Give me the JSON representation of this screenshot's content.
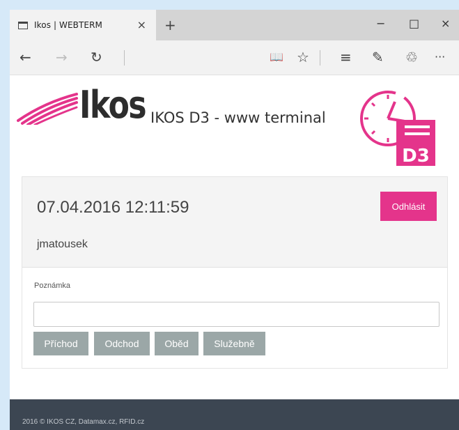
{
  "browser": {
    "tab_title": "Ikos | WEBTERM",
    "tab_close": "×",
    "new_tab": "+",
    "minimize": "−",
    "maximize": "□",
    "close": "×",
    "toolbar": {
      "back": "←",
      "forward": "→",
      "refresh": "↻",
      "reading_view": "📖",
      "favorite": "☆",
      "hub": "≡",
      "web_note": "✎",
      "share": "♲",
      "more": "···"
    }
  },
  "header": {
    "brand": "Ikos",
    "app_title": "IKOS D3 - www terminal",
    "d3_badge": "D3"
  },
  "session": {
    "datetime": "07.04.2016 12:11:59",
    "username": "jmatousek",
    "logout_label": "Odhlásit"
  },
  "form": {
    "note_label": "Poznámka",
    "note_value": "",
    "buttons": [
      "Příchod",
      "Odchod",
      "Oběd",
      "Služebně"
    ]
  },
  "footer": {
    "text": "2016 © IKOS CZ, Datamax.cz, RFID.cz"
  },
  "colors": {
    "accent": "#e4348b",
    "action_button": "#9ba7a7",
    "footer_bg": "#3c4652"
  }
}
